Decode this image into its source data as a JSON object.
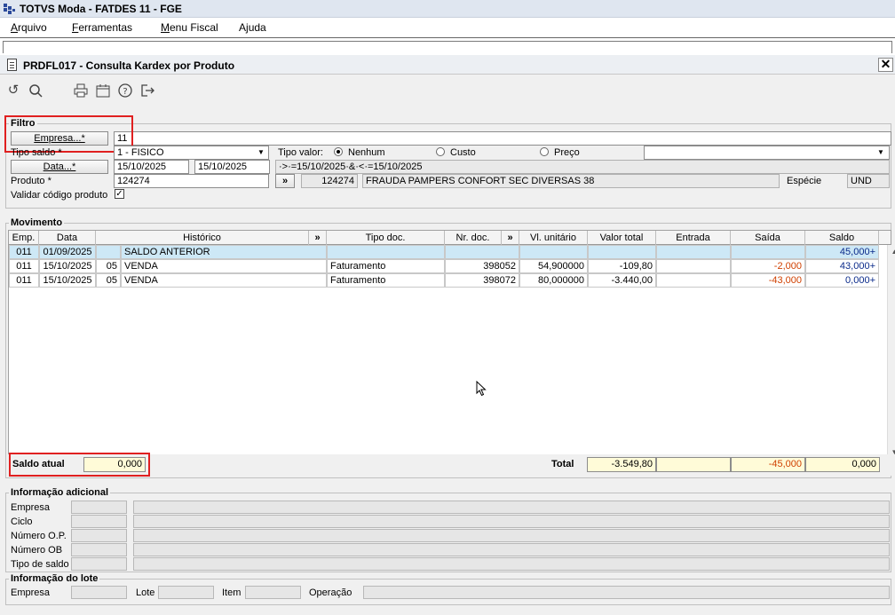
{
  "app": {
    "title": "TOTVS Moda - FATDES 11 - FGE"
  },
  "menu": [
    {
      "pre": "",
      "u": "A",
      "post": "rquivo"
    },
    {
      "pre": "",
      "u": "F",
      "post": "erramentas"
    },
    {
      "pre": "",
      "u": "M",
      "post": "enu Fiscal"
    },
    {
      "pre": "A",
      "u": "j",
      "post": "uda"
    }
  ],
  "window": {
    "title": "PRDFL017 - Consulta Kardex por Produto",
    "close": "✕"
  },
  "toolbar": {
    "icons": [
      "undo-icon",
      "search-icon",
      "print-icon",
      "calendar-icon",
      "help-icon",
      "exit-icon"
    ],
    "glyphs": [
      "↺",
      "⚲",
      "⎙",
      "▦",
      "?",
      "⇥"
    ]
  },
  "filtro": {
    "label": "Filtro",
    "empresa_button": "Empresa...*",
    "empresa_value": "11",
    "tipo_saldo_label": "Tipo saldo *",
    "tipo_saldo_value": "1 - FISICO",
    "tipo_valor_label": "Tipo valor:",
    "radio_nenhum": "Nenhum",
    "radio_custo": "Custo",
    "radio_preco": "Preço",
    "data_button": "Data...*",
    "data_inicio": "15/10/2025",
    "data_fim": "15/10/2025",
    "data_expr": "·>·=15/10/2025·&·<·=15/10/2025",
    "produto_label": "Produto *",
    "produto_value": "124274",
    "produto_go": "»",
    "produto_code": "124274",
    "produto_desc": "FRAUDA PAMPERS CONFORT SEC DIVERSAS 38",
    "especie_label": "Espécie",
    "especie_value": "UND",
    "validar_label": "Validar código produto",
    "validar_check": "✓"
  },
  "movimento": {
    "label": "Movimento",
    "headers": {
      "emp": "Emp.",
      "data": "Data",
      "historico": "Histórico",
      "more1": "»",
      "tipo_doc": "Tipo doc.",
      "nr_doc": "Nr. doc.",
      "more2": "»",
      "vl_unitario": "Vl. unitário",
      "valor_total": "Valor total",
      "entrada": "Entrada",
      "saida": "Saída",
      "saldo": "Saldo"
    },
    "rows": [
      {
        "emp": "011",
        "data": "01/09/2025",
        "code": "",
        "historico": "SALDO ANTERIOR",
        "tipo_doc": "",
        "nr_doc": "",
        "vl_unitario": "",
        "valor_total": "",
        "entrada": "",
        "saida": "",
        "saldo": "45,000+"
      },
      {
        "emp": "011",
        "data": "15/10/2025",
        "code": "05",
        "historico": "VENDA",
        "tipo_doc": "Faturamento",
        "nr_doc": "398052",
        "vl_unitario": "54,900000",
        "valor_total": "-109,80",
        "entrada": "",
        "saida": "-2,000",
        "saldo": "43,000+"
      },
      {
        "emp": "011",
        "data": "15/10/2025",
        "code": "05",
        "historico": "VENDA",
        "tipo_doc": "Faturamento",
        "nr_doc": "398072",
        "vl_unitario": "80,000000",
        "valor_total": "-3.440,00",
        "entrada": "",
        "saida": "-43,000",
        "saldo": "0,000+"
      }
    ],
    "saldo_atual_label": "Saldo atual",
    "saldo_atual_value": "0,000",
    "total_label": "Total",
    "total_valor": "-3.549,80",
    "total_entrada": "",
    "total_saida": "-45,000",
    "total_saldo": "0,000"
  },
  "info_adicional": {
    "label": "Informação adicional",
    "fields": [
      "Empresa",
      "Ciclo",
      "Número O.P.",
      "Número OB",
      "Tipo de saldo"
    ]
  },
  "info_lote": {
    "label": "Informação do lote",
    "empresa": "Empresa",
    "lote": "Lote",
    "item": "Item",
    "operacao": "Operação"
  },
  "colors": {
    "red_highlight": "#e02020",
    "selected_row": "#cde8f6",
    "negative": "#d04000",
    "positive": "#0a2a8a"
  }
}
